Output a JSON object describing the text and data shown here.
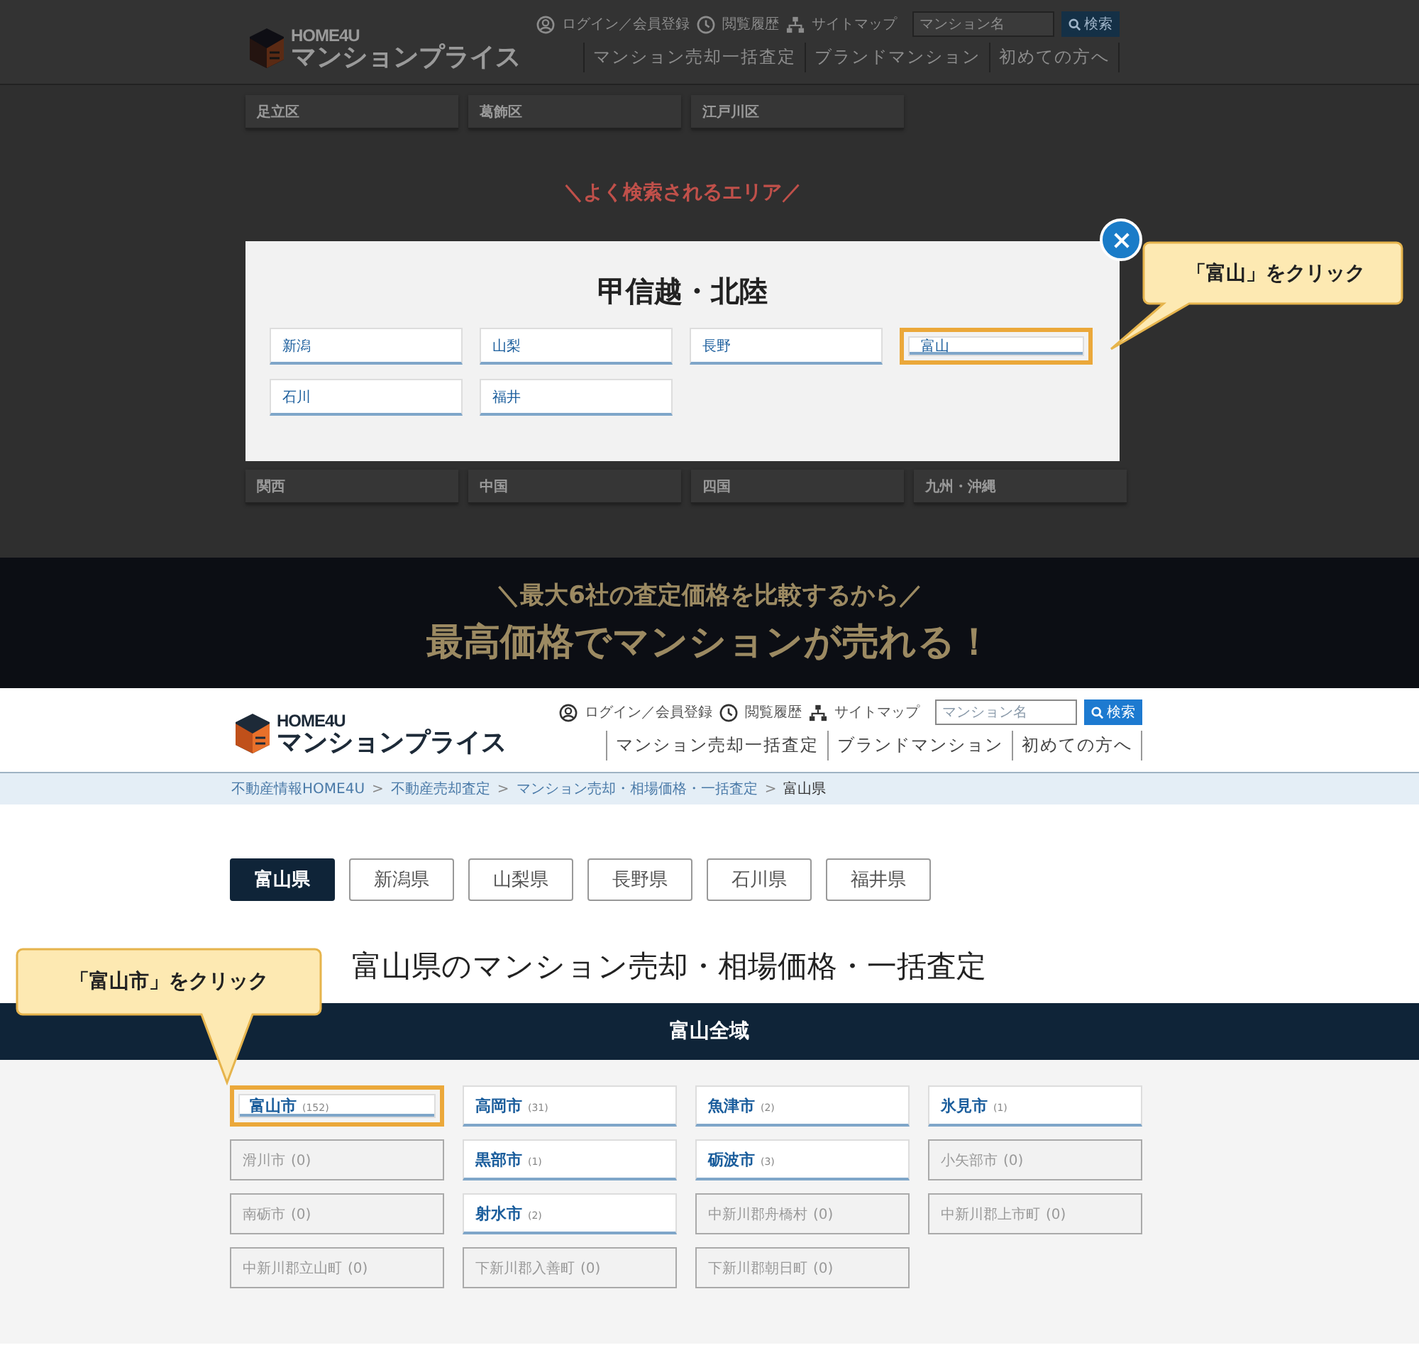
{
  "top_panel": {
    "header": {
      "logo": {
        "brand": "HOME4U",
        "name": "マンションプライス"
      },
      "util_links": [
        "ログイン／会員登録",
        "閲覧履歴",
        "サイトマップ"
      ],
      "search": {
        "placeholder": "マンション名",
        "button": "検索"
      },
      "nav": [
        "マンション売却一括査定",
        "ブランドマンション",
        "初めての方へ"
      ]
    },
    "wards": [
      "足立区",
      "葛飾区",
      "江戸川区"
    ],
    "popular_heading": "＼よく検索されるエリア／",
    "modal": {
      "title": "甲信越・北陸",
      "items": [
        {
          "label": "新潟",
          "highlighted": false
        },
        {
          "label": "山梨",
          "highlighted": false
        },
        {
          "label": "長野",
          "highlighted": false
        },
        {
          "label": "富山",
          "highlighted": true
        },
        {
          "label": "石川",
          "highlighted": false
        },
        {
          "label": "福井",
          "highlighted": false
        }
      ]
    },
    "callout": "「富山」をクリック",
    "regions": [
      "関西",
      "中国",
      "四国",
      "九州・沖縄"
    ],
    "banner": {
      "subtitle": "＼最大6社の査定価格を比較するから／",
      "headline": "最高価格でマンションが売れる！"
    }
  },
  "bottom_panel": {
    "header": {
      "logo": {
        "brand": "HOME4U",
        "name": "マンションプライス"
      },
      "util_links": [
        "ログイン／会員登録",
        "閲覧履歴",
        "サイトマップ"
      ],
      "search": {
        "placeholder": "マンション名",
        "button": "検索"
      },
      "nav": [
        "マンション売却一括査定",
        "ブランドマンション",
        "初めての方へ"
      ]
    },
    "breadcrumb": [
      "不動産情報HOME4U",
      "不動産売却査定",
      "マンション売却・相場価格・一括査定",
      "富山県"
    ],
    "breadcrumb_separator": ">",
    "prefecture_tabs": [
      {
        "label": "富山県",
        "selected": true
      },
      {
        "label": "新潟県",
        "selected": false
      },
      {
        "label": "山梨県",
        "selected": false
      },
      {
        "label": "長野県",
        "selected": false
      },
      {
        "label": "石川県",
        "selected": false
      },
      {
        "label": "福井県",
        "selected": false
      }
    ],
    "title": "富山県のマンション売却・相場価格・一括査定",
    "callout": "「富山市」をクリック",
    "area_band": "富山全域",
    "cities": [
      {
        "name": "富山市",
        "count": "(152)",
        "disabled": false,
        "highlighted": true
      },
      {
        "name": "高岡市",
        "count": "(31)",
        "disabled": false,
        "highlighted": false
      },
      {
        "name": "魚津市",
        "count": "(2)",
        "disabled": false,
        "highlighted": false
      },
      {
        "name": "氷見市",
        "count": "(1)",
        "disabled": false,
        "highlighted": false
      },
      {
        "name": "滑川市",
        "count": "(0)",
        "disabled": true,
        "highlighted": false
      },
      {
        "name": "黒部市",
        "count": "(1)",
        "disabled": false,
        "highlighted": false
      },
      {
        "name": "砺波市",
        "count": "(3)",
        "disabled": false,
        "highlighted": false
      },
      {
        "name": "小矢部市",
        "count": "(0)",
        "disabled": true,
        "highlighted": false
      },
      {
        "name": "南砺市",
        "count": "(0)",
        "disabled": true,
        "highlighted": false
      },
      {
        "name": "射水市",
        "count": "(2)",
        "disabled": false,
        "highlighted": false
      },
      {
        "name": "中新川郡舟橋村",
        "count": "(0)",
        "disabled": true,
        "highlighted": false
      },
      {
        "name": "中新川郡上市町",
        "count": "(0)",
        "disabled": true,
        "highlighted": false
      },
      {
        "name": "中新川郡立山町",
        "count": "(0)",
        "disabled": true,
        "highlighted": false
      },
      {
        "name": "下新川郡入善町",
        "count": "(0)",
        "disabled": true,
        "highlighted": false
      },
      {
        "name": "下新川郡朝日町",
        "count": "(0)",
        "disabled": true,
        "highlighted": false
      }
    ]
  }
}
